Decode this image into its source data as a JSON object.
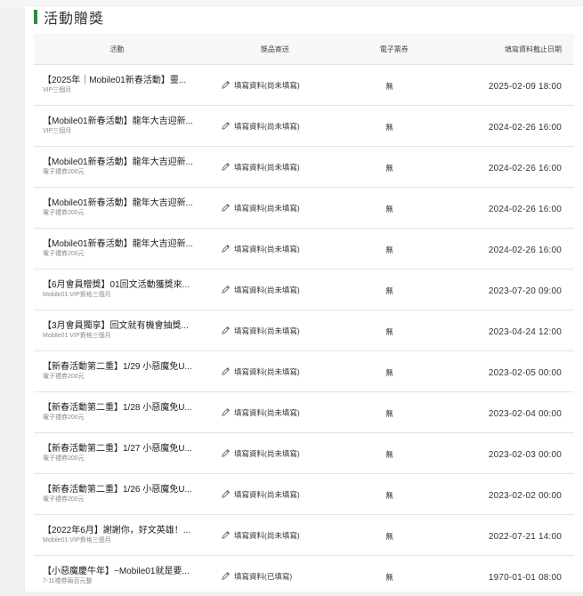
{
  "section": {
    "title": "活動贈獎"
  },
  "table": {
    "headers": {
      "activity": "活動",
      "shipping": "獎品寄送",
      "coupon": "電子票券",
      "deadline": "填寫資料截止日期"
    },
    "rows": [
      {
        "title": "【2025年｜Mobile01新春活動】靈...",
        "prize": "VIP三個月",
        "shipping": "填寫資料(尚未填寫)",
        "coupon": "無",
        "deadline": "2025-02-09 18:00"
      },
      {
        "title": "【Mobile01新春活動】龍年大吉迎新...",
        "prize": "VIP三個月",
        "shipping": "填寫資料(尚未填寫)",
        "coupon": "無",
        "deadline": "2024-02-26 16:00"
      },
      {
        "title": "【Mobile01新春活動】龍年大吉迎新...",
        "prize": "電子禮券200元",
        "shipping": "填寫資料(尚未填寫)",
        "coupon": "無",
        "deadline": "2024-02-26 16:00"
      },
      {
        "title": "【Mobile01新春活動】龍年大吉迎新...",
        "prize": "電子禮券200元",
        "shipping": "填寫資料(尚未填寫)",
        "coupon": "無",
        "deadline": "2024-02-26 16:00"
      },
      {
        "title": "【Mobile01新春活動】龍年大吉迎新...",
        "prize": "電子禮券200元",
        "shipping": "填寫資料(尚未填寫)",
        "coupon": "無",
        "deadline": "2024-02-26 16:00"
      },
      {
        "title": "【6月會員贈獎】01回文活動獲獎來...",
        "prize": "Mobile01 VIP資格三個月",
        "shipping": "填寫資料(尚未填寫)",
        "coupon": "無",
        "deadline": "2023-07-20 09:00"
      },
      {
        "title": "【3月會員獨享】回文就有機會抽獎...",
        "prize": "Mobile01 VIP資格三個月",
        "shipping": "填寫資料(尚未填寫)",
        "coupon": "無",
        "deadline": "2023-04-24 12:00"
      },
      {
        "title": "【新春活動第二重】1/29 小惡魔免U...",
        "prize": "電子禮券200元",
        "shipping": "填寫資料(尚未填寫)",
        "coupon": "無",
        "deadline": "2023-02-05 00:00"
      },
      {
        "title": "【新春活動第二重】1/28 小惡魔免U...",
        "prize": "電子禮券200元",
        "shipping": "填寫資料(尚未填寫)",
        "coupon": "無",
        "deadline": "2023-02-04 00:00"
      },
      {
        "title": "【新春活動第二重】1/27 小惡魔免U...",
        "prize": "電子禮券200元",
        "shipping": "填寫資料(尚未填寫)",
        "coupon": "無",
        "deadline": "2023-02-03 00:00"
      },
      {
        "title": "【新春活動第二重】1/26 小惡魔免U...",
        "prize": "電子禮券200元",
        "shipping": "填寫資料(尚未填寫)",
        "coupon": "無",
        "deadline": "2023-02-02 00:00"
      },
      {
        "title": "【2022年6月】謝謝你，好文英雄！...",
        "prize": "Mobile01 VIP資格三個月",
        "shipping": "填寫資料(尚未填寫)",
        "coupon": "無",
        "deadline": "2022-07-21 14:00"
      },
      {
        "title": "【小惡魔慶牛年】~Mobile01就是要...",
        "prize": "7-11禮券兩百元整",
        "shipping": "填寫資料(已填寫)",
        "coupon": "無",
        "deadline": "1970-01-01 08:00"
      }
    ]
  },
  "colors": {
    "accent": "#2e8b3e"
  },
  "icons": {
    "edit": "pencil-icon"
  }
}
